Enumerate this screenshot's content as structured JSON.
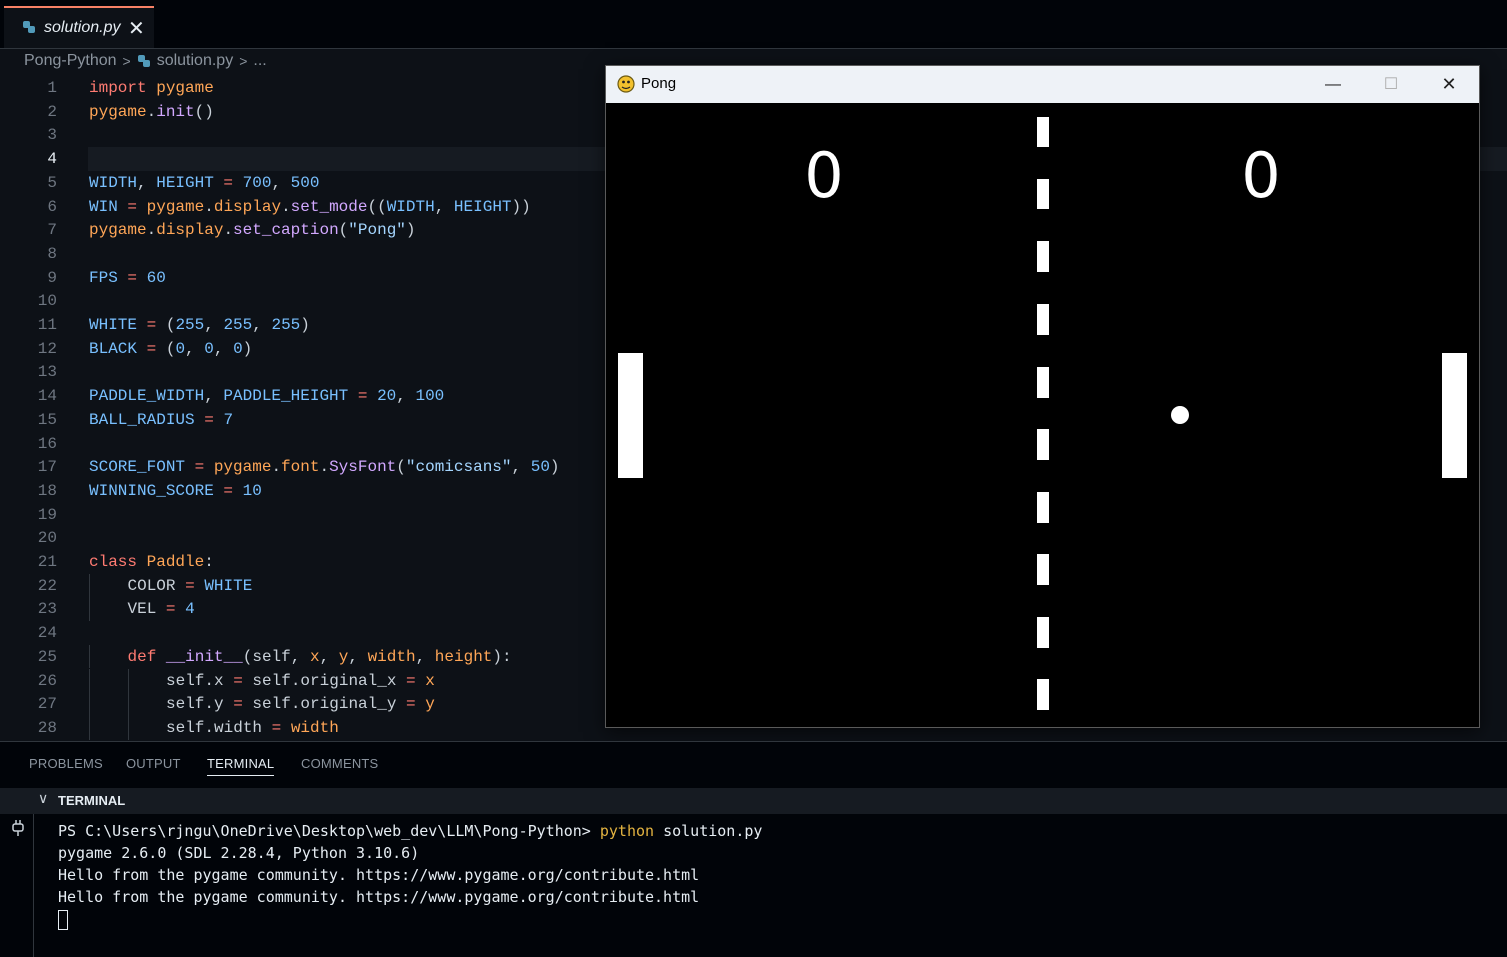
{
  "tab": {
    "filename": "solution.py",
    "close_glyph": "✕"
  },
  "breadcrumb": {
    "folder": "Pong-Python",
    "file": "solution.py",
    "more": "..."
  },
  "editor": {
    "active_line": 4,
    "lines": [
      {
        "n": "1",
        "indent": 0,
        "tokens": [
          [
            "kw",
            "import"
          ],
          [
            "pl",
            " "
          ],
          [
            "mod",
            "pygame"
          ]
        ]
      },
      {
        "n": "2",
        "indent": 0,
        "tokens": [
          [
            "mod",
            "pygame"
          ],
          [
            "pl",
            "."
          ],
          [
            "fn",
            "init"
          ],
          [
            "pl",
            "()"
          ]
        ]
      },
      {
        "n": "3",
        "indent": 0,
        "tokens": []
      },
      {
        "n": "4",
        "indent": 0,
        "tokens": []
      },
      {
        "n": "5",
        "indent": 0,
        "tokens": [
          [
            "cn",
            "WIDTH"
          ],
          [
            "pl",
            ", "
          ],
          [
            "cn",
            "HEIGHT"
          ],
          [
            "op",
            " = "
          ],
          [
            "num",
            "700"
          ],
          [
            "pl",
            ", "
          ],
          [
            "num",
            "500"
          ]
        ]
      },
      {
        "n": "6",
        "indent": 0,
        "tokens": [
          [
            "cn",
            "WIN"
          ],
          [
            "op",
            " = "
          ],
          [
            "mod",
            "pygame"
          ],
          [
            "pl",
            "."
          ],
          [
            "mod",
            "display"
          ],
          [
            "pl",
            "."
          ],
          [
            "fn",
            "set_mode"
          ],
          [
            "pl",
            "(("
          ],
          [
            "cn",
            "WIDTH"
          ],
          [
            "pl",
            ", "
          ],
          [
            "cn",
            "HEIGHT"
          ],
          [
            "pl",
            "))"
          ]
        ]
      },
      {
        "n": "7",
        "indent": 0,
        "tokens": [
          [
            "mod",
            "pygame"
          ],
          [
            "pl",
            "."
          ],
          [
            "mod",
            "display"
          ],
          [
            "pl",
            "."
          ],
          [
            "fn",
            "set_caption"
          ],
          [
            "pl",
            "("
          ],
          [
            "str",
            "\"Pong\""
          ],
          [
            "pl",
            ")"
          ]
        ]
      },
      {
        "n": "8",
        "indent": 0,
        "tokens": []
      },
      {
        "n": "9",
        "indent": 0,
        "tokens": [
          [
            "cn",
            "FPS"
          ],
          [
            "op",
            " = "
          ],
          [
            "num",
            "60"
          ]
        ]
      },
      {
        "n": "10",
        "indent": 0,
        "tokens": []
      },
      {
        "n": "11",
        "indent": 0,
        "tokens": [
          [
            "cn",
            "WHITE"
          ],
          [
            "op",
            " = "
          ],
          [
            "pl",
            "("
          ],
          [
            "num",
            "255"
          ],
          [
            "pl",
            ", "
          ],
          [
            "num",
            "255"
          ],
          [
            "pl",
            ", "
          ],
          [
            "num",
            "255"
          ],
          [
            "pl",
            ")"
          ]
        ]
      },
      {
        "n": "12",
        "indent": 0,
        "tokens": [
          [
            "cn",
            "BLACK"
          ],
          [
            "op",
            " = "
          ],
          [
            "pl",
            "("
          ],
          [
            "num",
            "0"
          ],
          [
            "pl",
            ", "
          ],
          [
            "num",
            "0"
          ],
          [
            "pl",
            ", "
          ],
          [
            "num",
            "0"
          ],
          [
            "pl",
            ")"
          ]
        ]
      },
      {
        "n": "13",
        "indent": 0,
        "tokens": []
      },
      {
        "n": "14",
        "indent": 0,
        "tokens": [
          [
            "cn",
            "PADDLE_WIDTH"
          ],
          [
            "pl",
            ", "
          ],
          [
            "cn",
            "PADDLE_HEIGHT"
          ],
          [
            "op",
            " = "
          ],
          [
            "num",
            "20"
          ],
          [
            "pl",
            ", "
          ],
          [
            "num",
            "100"
          ]
        ]
      },
      {
        "n": "15",
        "indent": 0,
        "tokens": [
          [
            "cn",
            "BALL_RADIUS"
          ],
          [
            "op",
            " = "
          ],
          [
            "num",
            "7"
          ]
        ]
      },
      {
        "n": "16",
        "indent": 0,
        "tokens": []
      },
      {
        "n": "17",
        "indent": 0,
        "tokens": [
          [
            "cn",
            "SCORE_FONT"
          ],
          [
            "op",
            " = "
          ],
          [
            "mod",
            "pygame"
          ],
          [
            "pl",
            "."
          ],
          [
            "mod",
            "font"
          ],
          [
            "pl",
            "."
          ],
          [
            "fn",
            "SysFont"
          ],
          [
            "pl",
            "("
          ],
          [
            "str",
            "\"comicsans\""
          ],
          [
            "pl",
            ", "
          ],
          [
            "num",
            "50"
          ],
          [
            "pl",
            ")"
          ]
        ]
      },
      {
        "n": "18",
        "indent": 0,
        "tokens": [
          [
            "cn",
            "WINNING_SCORE"
          ],
          [
            "op",
            " = "
          ],
          [
            "num",
            "10"
          ]
        ]
      },
      {
        "n": "19",
        "indent": 0,
        "tokens": []
      },
      {
        "n": "20",
        "indent": 0,
        "tokens": []
      },
      {
        "n": "21",
        "indent": 0,
        "tokens": [
          [
            "kw",
            "class"
          ],
          [
            "pl",
            " "
          ],
          [
            "mod",
            "Paddle"
          ],
          [
            "pl",
            ":"
          ]
        ]
      },
      {
        "n": "22",
        "indent": 1,
        "tokens": [
          [
            "pl",
            "COLOR"
          ],
          [
            "op",
            " = "
          ],
          [
            "cn",
            "WHITE"
          ]
        ]
      },
      {
        "n": "23",
        "indent": 1,
        "tokens": [
          [
            "pl",
            "VEL"
          ],
          [
            "op",
            " = "
          ],
          [
            "num",
            "4"
          ]
        ]
      },
      {
        "n": "24",
        "indent": 0,
        "tokens": []
      },
      {
        "n": "25",
        "indent": 1,
        "tokens": [
          [
            "kw",
            "def"
          ],
          [
            "pl",
            " "
          ],
          [
            "fn",
            "__init__"
          ],
          [
            "pl",
            "(self, "
          ],
          [
            "mod",
            "x"
          ],
          [
            "pl",
            ", "
          ],
          [
            "mod",
            "y"
          ],
          [
            "pl",
            ", "
          ],
          [
            "mod",
            "width"
          ],
          [
            "pl",
            ", "
          ],
          [
            "mod",
            "height"
          ],
          [
            "pl",
            "):"
          ]
        ]
      },
      {
        "n": "26",
        "indent": 2,
        "tokens": [
          [
            "pl",
            "self.x"
          ],
          [
            "op",
            " = "
          ],
          [
            "pl",
            "self.original_x"
          ],
          [
            "op",
            " = "
          ],
          [
            "mod",
            "x"
          ]
        ]
      },
      {
        "n": "27",
        "indent": 2,
        "tokens": [
          [
            "pl",
            "self.y"
          ],
          [
            "op",
            " = "
          ],
          [
            "pl",
            "self.original_y"
          ],
          [
            "op",
            " = "
          ],
          [
            "mod",
            "y"
          ]
        ]
      },
      {
        "n": "28",
        "indent": 2,
        "tokens": [
          [
            "pl",
            "self.width"
          ],
          [
            "op",
            " = "
          ],
          [
            "mod",
            "width"
          ]
        ]
      }
    ]
  },
  "pong_window": {
    "title": "Pong",
    "controls": {
      "minimize": "—",
      "maximize": "☐",
      "close": "✕"
    },
    "score_left": "0",
    "score_right": "0"
  },
  "panel": {
    "tabs": [
      "PROBLEMS",
      "OUTPUT",
      "TERMINAL",
      "COMMENTS"
    ],
    "active_tab": "TERMINAL",
    "terminal_header": "TERMINAL",
    "terminal": {
      "prompt": "PS C:\\Users\\rjngu\\OneDrive\\Desktop\\web_dev\\LLM\\Pong-Python> ",
      "command": "python",
      "command_arg": " solution.py",
      "lines": [
        "pygame 2.6.0 (SDL 2.28.4, Python 3.10.6)",
        "Hello from the pygame community. https://www.pygame.org/contribute.html",
        "Hello from the pygame community. https://www.pygame.org/contribute.html"
      ]
    }
  },
  "colors": {
    "editor_bg": "#0d1117",
    "keyword": "#ff7b72",
    "module": "#ffa657",
    "function": "#d2a8ff",
    "constant": "#79c0ff",
    "string": "#a5d6ff",
    "terminal_command": "#e3b341"
  }
}
